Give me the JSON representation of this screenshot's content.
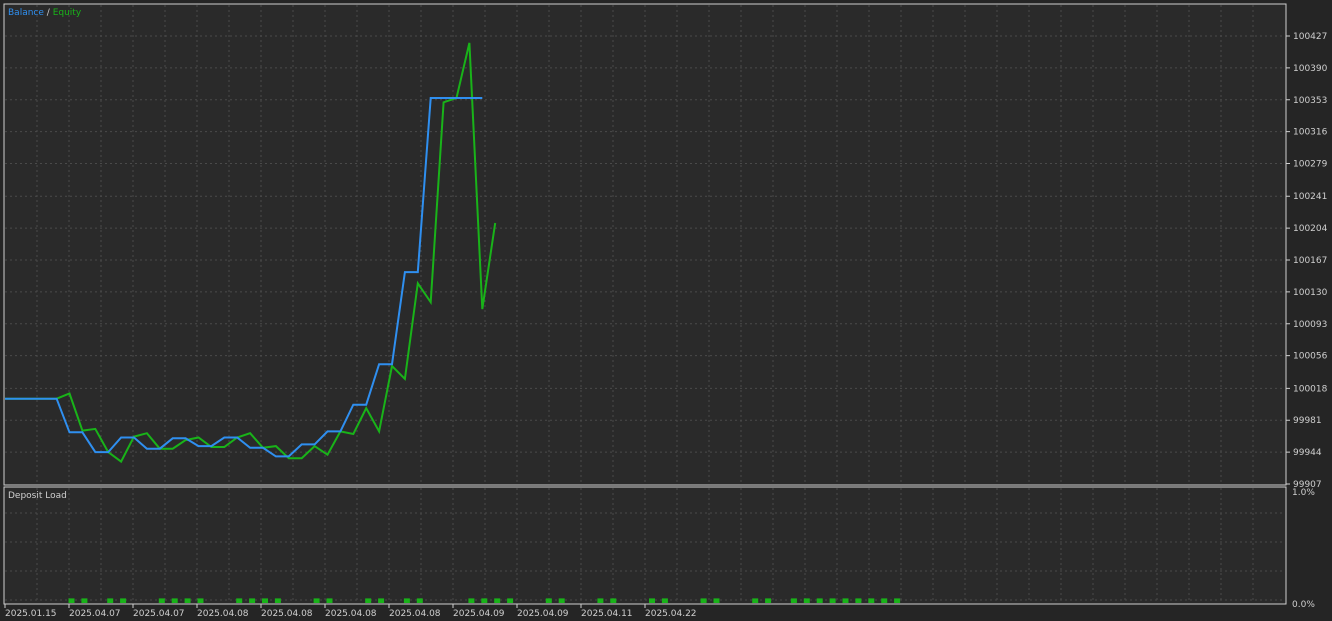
{
  "colors": {
    "background": "#2a2a2a",
    "grid": "#4a4a4a",
    "border": "#d0d0d0",
    "balance": "#2f8ff0",
    "equity": "#19b319",
    "deposit": "#19b319",
    "text": "#cfcfcf"
  },
  "chart_data": [
    {
      "type": "line",
      "title": "",
      "legend": {
        "placement": "top-left",
        "separator": "/"
      },
      "series": [
        {
          "name": "Balance",
          "values": [
            100006,
            100006,
            100006,
            100006,
            100006,
            99967,
            99967,
            99944,
            99944,
            99961,
            99961,
            99948,
            99948,
            99960,
            99960,
            99951,
            99951,
            99961,
            99961,
            99949,
            99949,
            99939,
            99939,
            99953,
            99953,
            99968,
            99968,
            99999,
            99999,
            100046,
            100046,
            100153,
            100153,
            100355,
            100355,
            100355,
            100355,
            100355
          ]
        },
        {
          "name": "Equity",
          "values": [
            100006,
            100006,
            100006,
            100006,
            100006,
            100012,
            99969,
            99971,
            99944,
            99933,
            99962,
            99966,
            99948,
            99948,
            99958,
            99961,
            99950,
            99950,
            99961,
            99966,
            99949,
            99951,
            99937,
            99937,
            99951,
            99941,
            99968,
            99965,
            99995,
            99968,
            100044,
            100029,
            100140,
            100118,
            100350,
            100355,
            100419,
            100110,
            100210
          ]
        }
      ],
      "y_axis": {
        "ticks": [
          "100427",
          "100390",
          "100353",
          "100316",
          "100279",
          "100241",
          "100204",
          "100167",
          "100130",
          "100093",
          "100056",
          "100018",
          "99981",
          "99944",
          "99907"
        ],
        "ylim": [
          99907,
          100427
        ]
      },
      "grid": true
    },
    {
      "type": "bar",
      "title": "Deposit Load",
      "y_axis": {
        "ticks": [
          "1.0%",
          "0.0%"
        ],
        "ylim": [
          0,
          1.0
        ]
      },
      "bar_positions": [
        5,
        6,
        8,
        9,
        12,
        13,
        14,
        15,
        18,
        19,
        20,
        21,
        24,
        25,
        28,
        29,
        31,
        32,
        36,
        37,
        38,
        39,
        42,
        43,
        46,
        47,
        50,
        51,
        54,
        55,
        58,
        59,
        61,
        62,
        63,
        64,
        65,
        66,
        67,
        68,
        69
      ],
      "values": [
        0.04,
        0.04,
        0.04,
        0.04,
        0.04,
        0.04,
        0.04,
        0.04,
        0.04,
        0.04,
        0.04,
        0.04,
        0.04,
        0.04,
        0.04,
        0.04,
        0.04,
        0.04,
        0.04,
        0.04,
        0.04,
        0.04,
        0.04,
        0.04,
        0.04,
        0.04,
        0.04,
        0.04,
        0.04,
        0.04,
        0.04,
        0.04,
        0.04,
        0.04,
        0.04,
        0.04,
        0.04,
        0.04,
        0.04,
        0.04,
        0.04
      ],
      "grid": true
    }
  ],
  "x_axis": {
    "ticks": [
      "2025.01.15",
      "2025.04.07",
      "2025.04.07",
      "2025.04.08",
      "2025.04.08",
      "2025.04.08",
      "2025.04.08",
      "2025.04.09",
      "2025.04.09",
      "2025.04.11",
      "2025.04.22"
    ]
  }
}
